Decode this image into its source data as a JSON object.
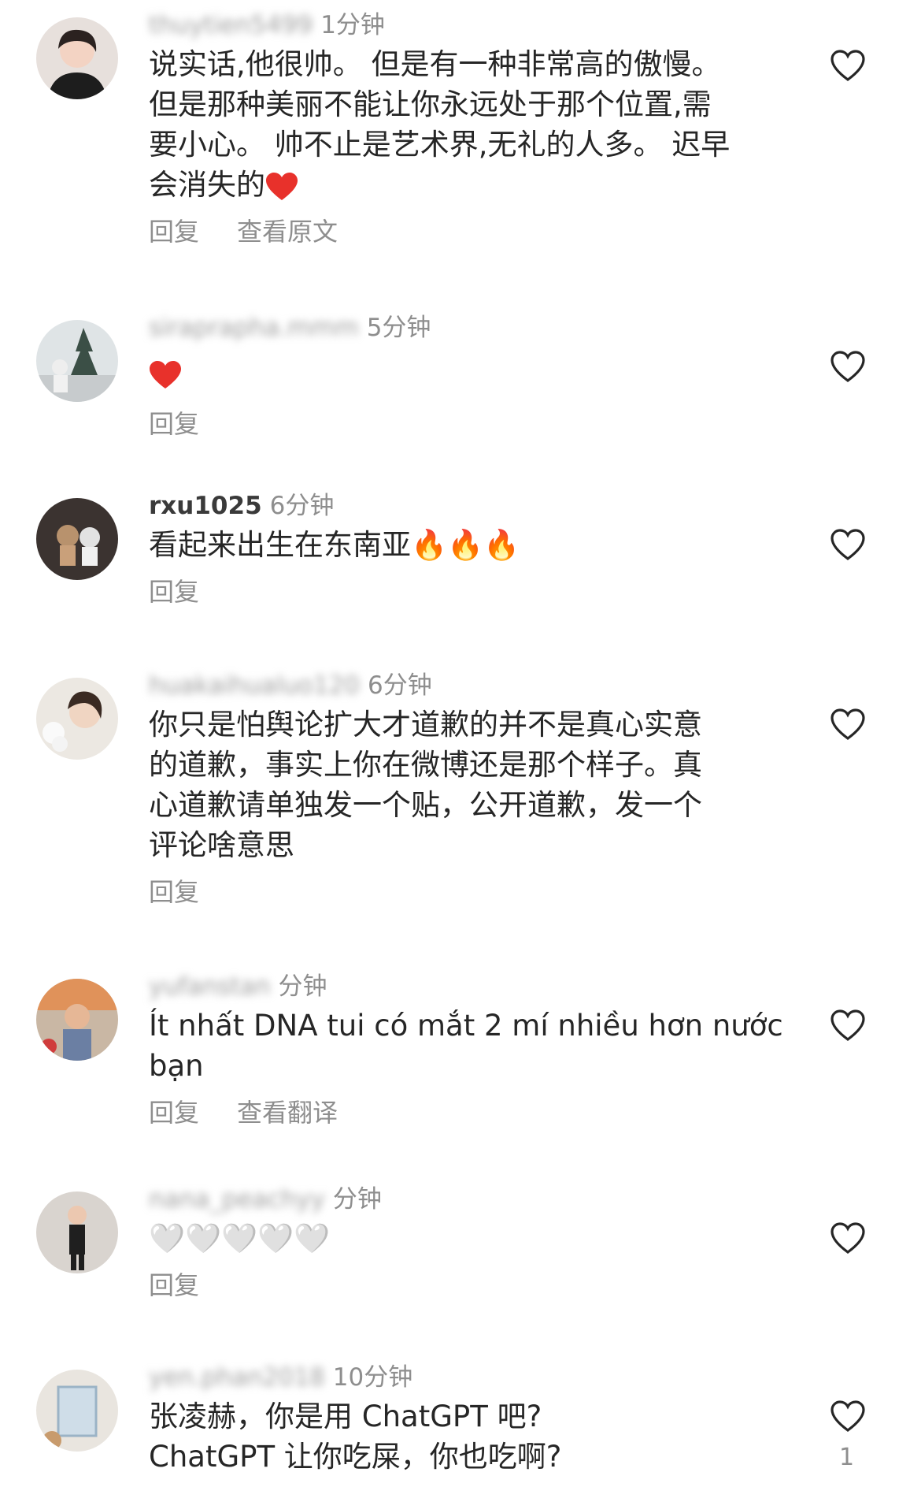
{
  "comments": [
    {
      "username": "thuytien5499",
      "time": "1分钟",
      "text": "说实话,他很帅。 但是有一种非常高的傲慢。\n但是那种美丽不能让你永远处于那个位置,需\n要小心。 帅不止是艺术界,无礼的人多。 迟早\n会消失的",
      "emoji": "red-heart",
      "reply": "回复",
      "extra": "查看原文"
    },
    {
      "username": "siraprapha.mmm",
      "time": "5分钟",
      "text": "",
      "emoji": "red-heart",
      "reply": "回复"
    },
    {
      "username": "rxu1025",
      "time": "6分钟",
      "text": "看起来出生在东南亚🔥🔥🔥",
      "reply": "回复"
    },
    {
      "username": "huakaihualuo120",
      "time": "6分钟",
      "text": "你只是怕舆论扩大才道歉的并不是真心实意\n的道歉，事实上你在微博还是那个样子。真\n心道歉请单独发一个贴，公开道歉，发一个\n评论啥意思",
      "reply": "回复"
    },
    {
      "username": "yufanstan",
      "time": "分钟",
      "text": "Ít nhất DNA tui có mắt 2 mí nhiều hơn nước\nbạn",
      "reply": "回复",
      "extra": "查看翻译"
    },
    {
      "username": "nana_peachyy",
      "time": "分钟",
      "text": "🤍🤍🤍🤍🤍",
      "reply": "回复"
    },
    {
      "username": "yen.phan2018",
      "time": "10分钟",
      "text": "张凌赫，你是用 ChatGPT 吧?\nChatGPT 让你吃屎，你也吃啊?",
      "like_count": "1"
    }
  ],
  "icons": {
    "like": "heart-outline-icon",
    "emoji_heart": "red-heart-icon"
  },
  "colors": {
    "text": "#262626",
    "muted": "#8e8e8e",
    "heart_red": "#e8312b"
  }
}
